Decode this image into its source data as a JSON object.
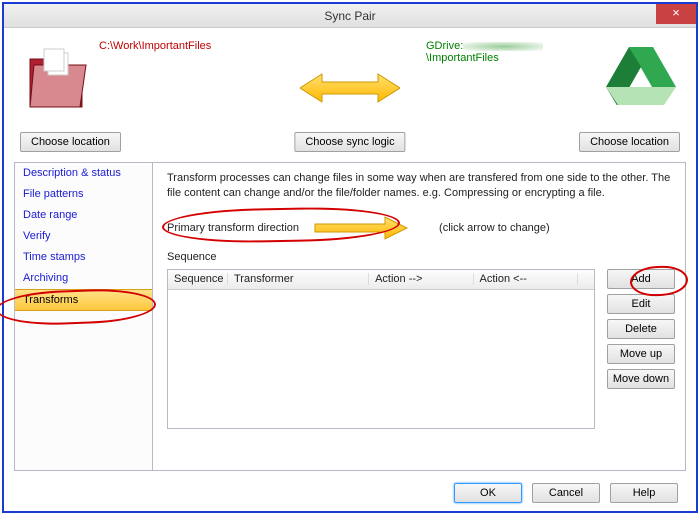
{
  "title": "Sync Pair",
  "paths": {
    "left": "C:\\Work\\ImportantFiles",
    "right_prefix": "GDrive:",
    "right_suffix": "\\ImportantFiles"
  },
  "buttons": {
    "choose_location": "Choose location",
    "choose_sync_logic": "Choose sync logic"
  },
  "sidebar": {
    "items": [
      {
        "id": "description",
        "label": "Description & status"
      },
      {
        "id": "patterns",
        "label": "File patterns"
      },
      {
        "id": "daterange",
        "label": "Date range"
      },
      {
        "id": "verify",
        "label": "Verify"
      },
      {
        "id": "timestamps",
        "label": "Time stamps"
      },
      {
        "id": "archiving",
        "label": "Archiving"
      },
      {
        "id": "transforms",
        "label": "Transforms",
        "selected": true
      }
    ]
  },
  "main": {
    "description": "Transform processes can change files in some way when are transfered from one side to the other.  The file content can change and/or the file/folder names.  e.g. Compressing or encrypting a file.",
    "ptd_label": "Primary transform direction",
    "ptd_hint": "(click arrow to change)",
    "sequence_label": "Sequence",
    "columns": {
      "c1": "Sequence",
      "c2": "Transformer",
      "c3": "Action -->",
      "c4": "Action <--"
    }
  },
  "action_buttons": {
    "add": "Add",
    "edit": "Edit",
    "delete": "Delete",
    "moveup": "Move up",
    "movedown": "Move down"
  },
  "footer": {
    "ok": "OK",
    "cancel": "Cancel",
    "help": "Help"
  }
}
